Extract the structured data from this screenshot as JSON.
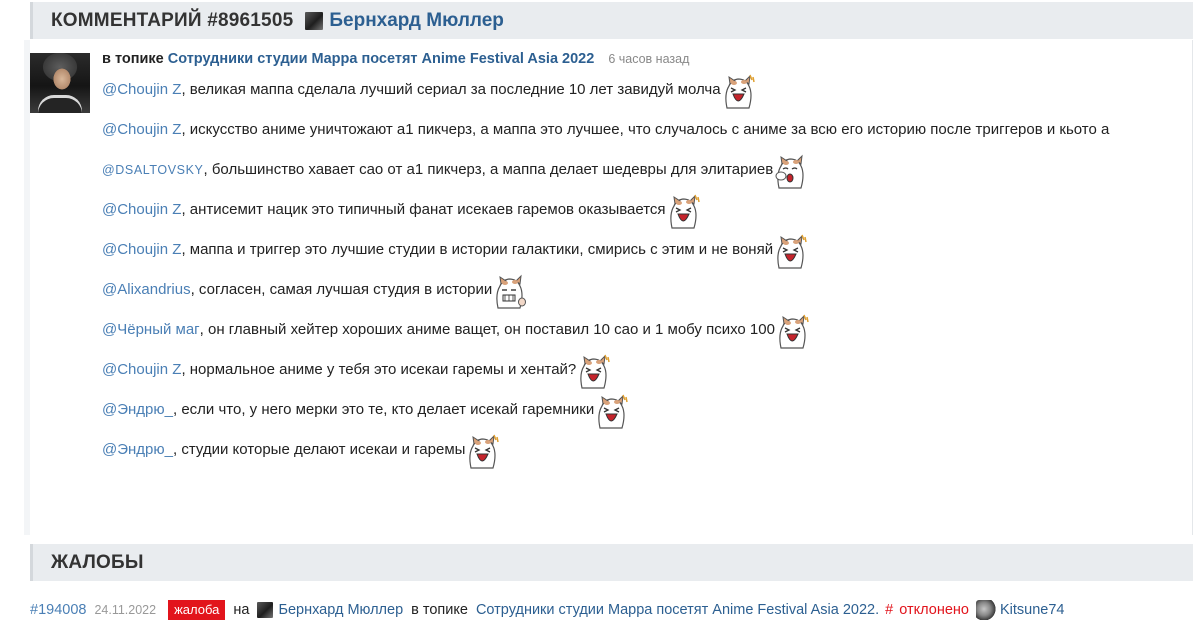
{
  "comment": {
    "header_title": "КОММЕНТАРИЙ #8961505",
    "author": "Бернхард Мюллер",
    "topic_prefix": "в топике",
    "topic_title": "Сотрудники студии Мappa посетят Anime Festival Asia 2022",
    "time_ago": "6 часов назад",
    "lines": [
      {
        "mention": "@Choujin Z",
        "text": ", великая маппа сделала лучший сериал за последние 10 лет завидуй молча",
        "emote": "screaming-cat-emote"
      },
      {
        "mention": "@Choujin Z",
        "text": ", искусство аниме уничтожают а1 пикчерз, а маппа это лучшее, что случалось с аниме за всю его историю после триггеров и кьото а",
        "emote": ""
      },
      {
        "mention": "@DSALTOVSKY",
        "text": ", большинство хавает сао от а1 пикчерз, а маппа делает шедевры для элитариев",
        "emote": "facepalm-cat-emote"
      },
      {
        "mention": "@Choujin Z",
        "text": ", антисемит нацик это типичный фанат исекаев гаремов оказывается",
        "emote": "screaming-cat-emote"
      },
      {
        "mention": "@Choujin Z",
        "text": ", маппа и триггер это лучшие студии в истории галактики, смирись с этим и не воняй",
        "emote": "screaming-cat-emote"
      },
      {
        "mention": "@Alixandrius",
        "text": ", согласен, самая лучшая студия в истории",
        "emote": "nervous-cat-emote"
      },
      {
        "mention": "@Чёрный маг",
        "text": ", он главный хейтер хороших аниме ващет, он поставил 10 сао и 1 мобу психо 100",
        "emote": "screaming-cat-emote"
      },
      {
        "mention": "@Choujin Z",
        "text": ", нормальное аниме у тебя это исекаи гаремы и хентай?",
        "emote": "screaming-cat-emote"
      },
      {
        "mention": "@Эндрю_",
        "text": ", если что, у него мерки это те, кто делает исекай гаремники",
        "emote": "screaming-cat-emote"
      },
      {
        "mention": "@Эндрю_",
        "text": ", студии которые делают исекаи и гаремы",
        "emote": "screaming-cat-emote"
      }
    ]
  },
  "complaints": {
    "header_title": "ЖАЛОБЫ",
    "item": {
      "id": "#194008",
      "date": "24.11.2022",
      "badge": "жалоба",
      "on_word": "на",
      "author": "Бернхард Мюллер",
      "topic_prefix": "в топике",
      "topic_title": "Сотрудники студии Мappa посетят Anime Festival Asia 2022.",
      "hash": "#",
      "status": "отклонено",
      "moderator": "Kitsune74"
    }
  },
  "colors": {
    "link": "#2c5f91",
    "mention": "#4a7fb5",
    "header_bg": "#e9ecef",
    "danger": "#e2141c"
  }
}
